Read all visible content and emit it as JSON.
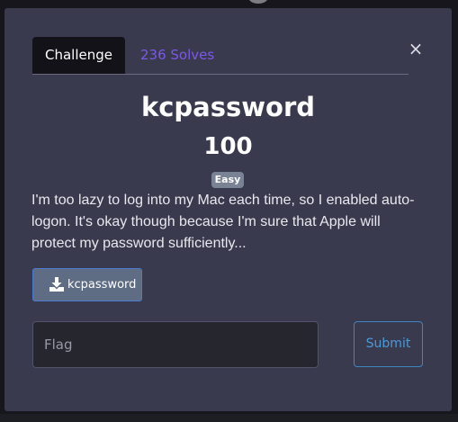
{
  "modal": {
    "close_glyph": "×",
    "tabs": [
      {
        "label": "Challenge",
        "active": true
      },
      {
        "label": "236 Solves",
        "active": false
      }
    ],
    "challenge_name": "kcpassword",
    "points": "100",
    "difficulty": "Easy",
    "description": "I'm too lazy to log into my Mac each time, so I enabled auto-logon. It's okay though because I'm sure that Apple will protect my password sufficiently...",
    "download": {
      "label": "kcpassword",
      "icon": "download-icon"
    },
    "flag_input": {
      "placeholder": "Flag",
      "value": ""
    },
    "submit_label": "Submit"
  },
  "colors": {
    "page_bg": "#16161c",
    "modal_bg": "#3a3a4f",
    "active_tab_bg": "#121218",
    "solves_tab_text": "#7b59e6",
    "badge_bg": "#7a8296",
    "download_button_bg": "#5e6c84",
    "submit_border": "#3f86c0"
  }
}
